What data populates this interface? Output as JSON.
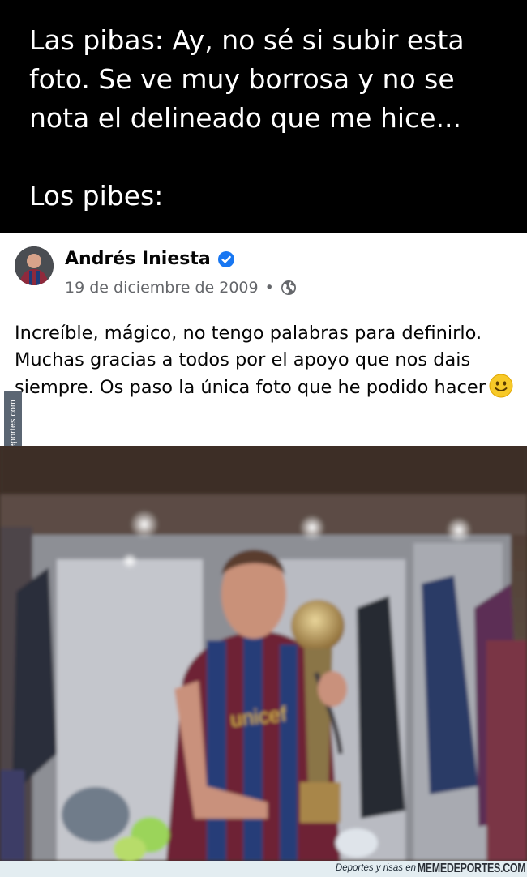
{
  "caption": {
    "line1": "Las pibas: Ay, no sé si subir esta foto. Se ve muy borrosa y no se nota el delineado que me hice...",
    "line2": "Los pibes:"
  },
  "post": {
    "author": "Andrés Iniesta",
    "date": "19 de diciembre de 2009",
    "separator": "•",
    "text": "Increíble, mágico, no tengo palabras para definirlo. Muchas gracias a todos por el apoyo que nos dais siempre. Os paso la única foto que he podido hacer",
    "icons": [
      "avatar",
      "verified-badge-icon",
      "globe-icon",
      "smiley-emoji-icon"
    ],
    "verified_color": "#1877f2"
  },
  "photo": {
    "shirt_text": "unicef"
  },
  "watermark": {
    "side_text": "Memedeportes.com",
    "footer_small": "Deportes y risas en",
    "footer_brand": "MEMEDEPORTES.COM"
  }
}
